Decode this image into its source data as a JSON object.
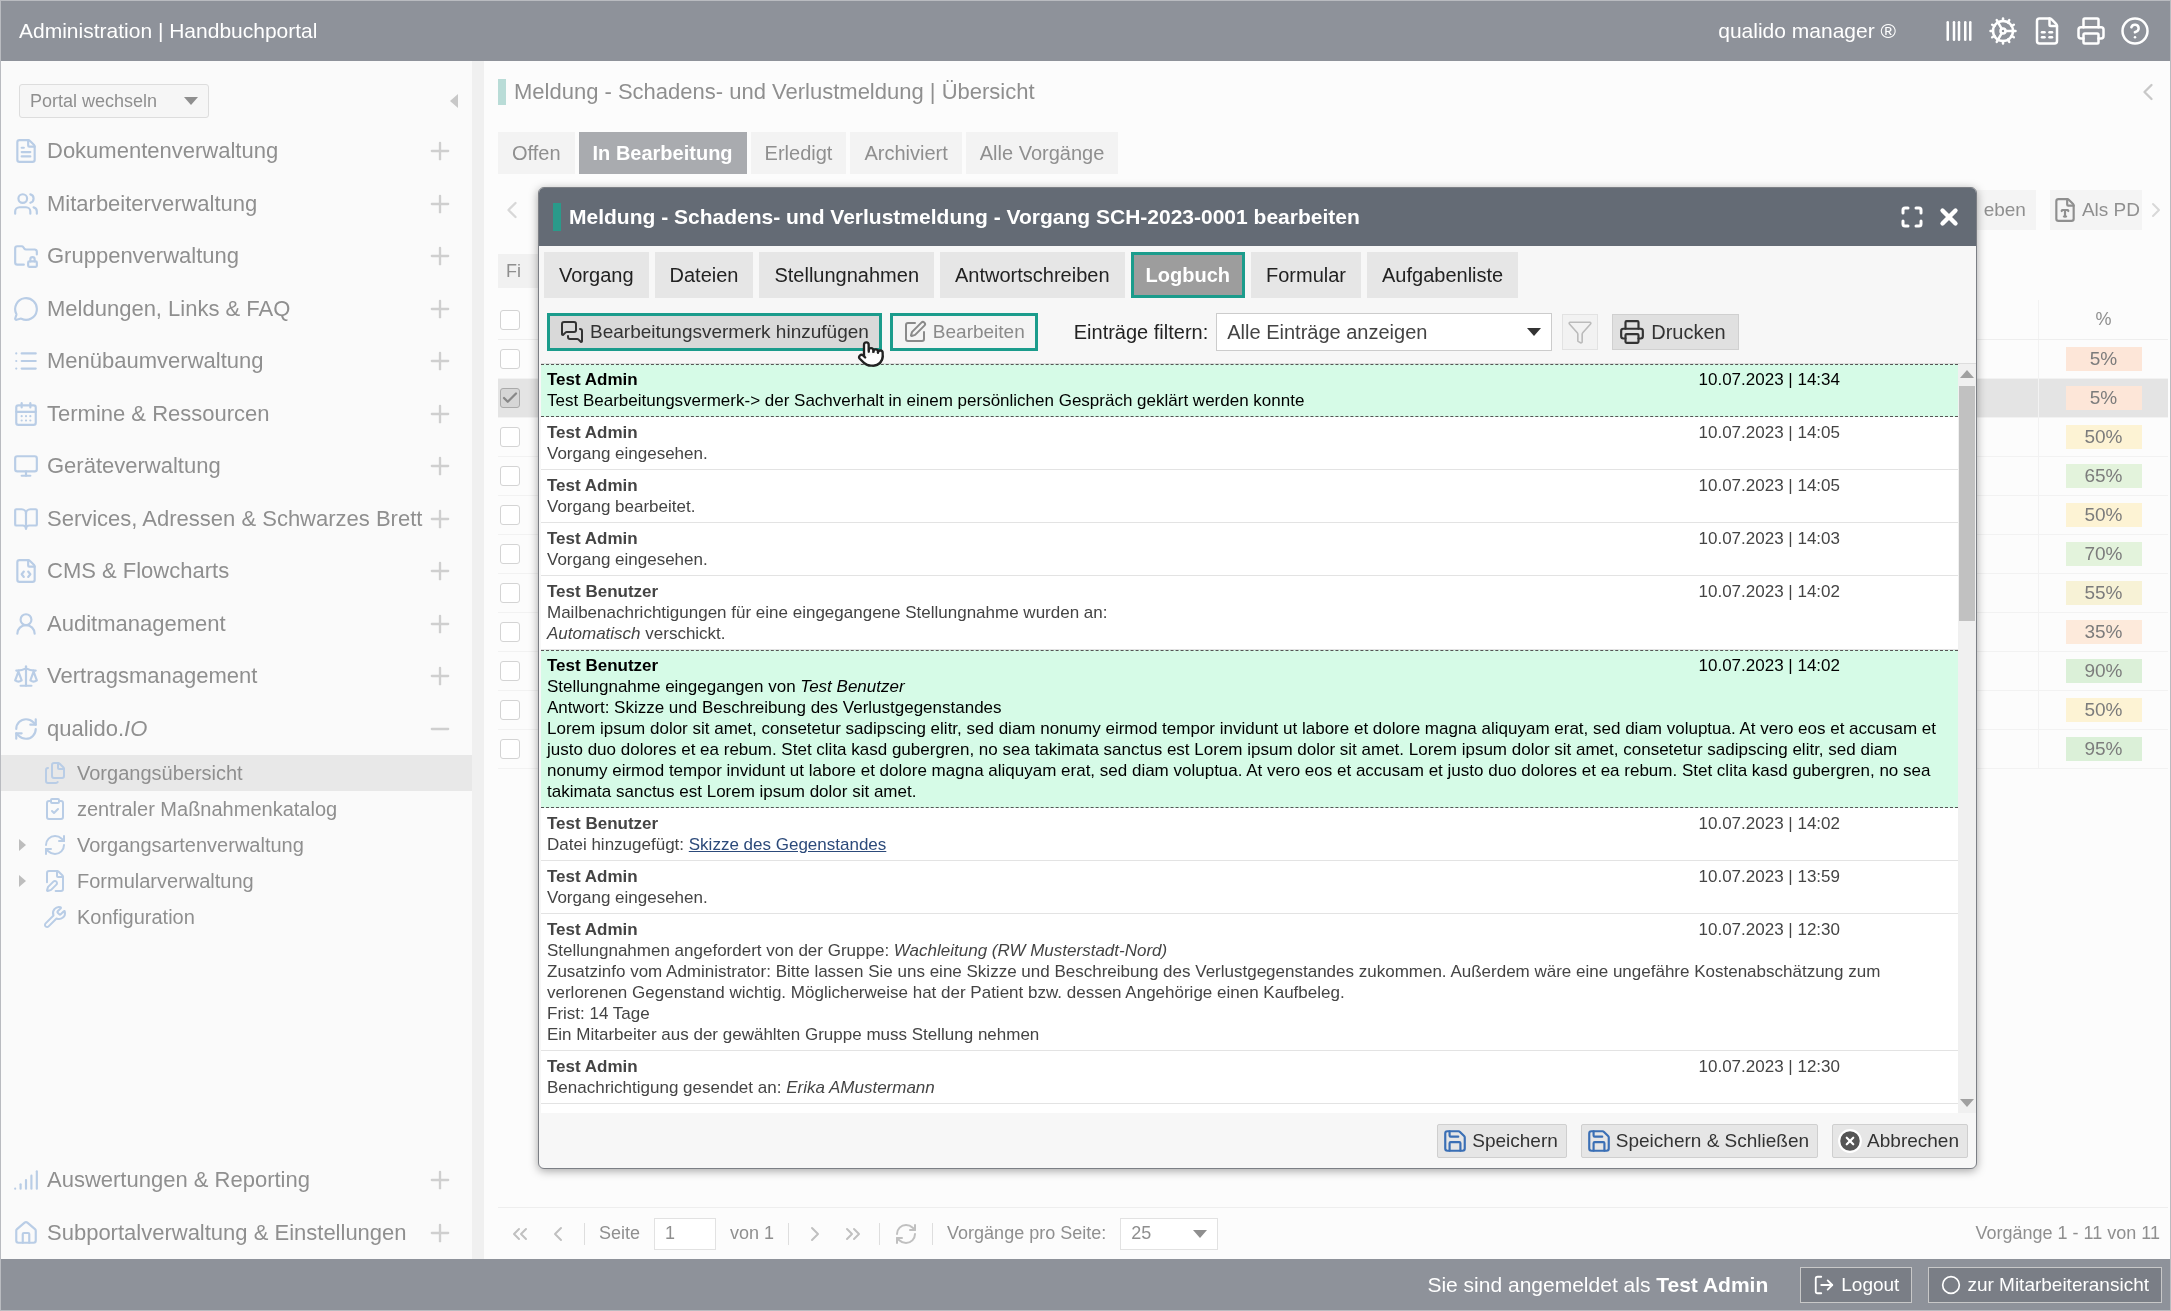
{
  "header": {
    "title": "Administration | Handbuchportal",
    "brand": "qualido manager ®"
  },
  "sidebar": {
    "portal_select": "Portal wechseln",
    "items": [
      {
        "label": "Dokumentenverwaltung",
        "expanded": false
      },
      {
        "label": "Mitarbeiterverwaltung",
        "expanded": false
      },
      {
        "label": "Gruppenverwaltung",
        "expanded": false
      },
      {
        "label": "Meldungen, Links & FAQ",
        "expanded": false
      },
      {
        "label": "Menübaumverwaltung",
        "expanded": false
      },
      {
        "label": "Termine & Ressourcen",
        "expanded": false
      },
      {
        "label": "Geräteverwaltung",
        "expanded": false
      },
      {
        "label": "Services, Adressen & Schwarzes Brett",
        "expanded": false
      },
      {
        "label": "CMS & Flowcharts",
        "expanded": false
      },
      {
        "label": "Auditmanagement",
        "expanded": false
      },
      {
        "label": "Vertragsmanagement",
        "expanded": false
      },
      {
        "label": "qualido.*IO*",
        "expanded": true,
        "children": [
          {
            "label": "Vorgangsübersicht",
            "kind": "page",
            "selected": true
          },
          {
            "label": "zentraler Maßnahmenkatalog",
            "kind": "page",
            "selected": false
          },
          {
            "label": "Vorgangsartenverwaltung",
            "kind": "group",
            "selected": false
          },
          {
            "label": "Formularverwaltung",
            "kind": "group",
            "selected": false
          },
          {
            "label": "Konfiguration",
            "kind": "page",
            "selected": false
          }
        ]
      }
    ],
    "bottom_items": [
      {
        "label": "Auswertungen & Reporting",
        "expanded": false
      },
      {
        "label": "Subportalverwaltung & Einstellungen",
        "expanded": false
      }
    ]
  },
  "content": {
    "title": "Meldung - Schadens- und Verlustmeldung | Übersicht",
    "tabs": [
      {
        "label": "Offen",
        "selected": false
      },
      {
        "label": "In Bearbeitung",
        "selected": true
      },
      {
        "label": "Erledigt",
        "selected": false
      },
      {
        "label": "Archiviert",
        "selected": false
      },
      {
        "label": "Alle Vorgänge",
        "selected": false
      }
    ],
    "toolbar_buttons": [
      {
        "label": "eben",
        "kind": "text"
      },
      {
        "label": "Als PD",
        "kind": "pdf"
      }
    ],
    "filter_stub": "Fi",
    "table": {
      "percent_header": "%",
      "select_all_checked": false,
      "rows": [
        {
          "checked": false,
          "selected": false,
          "percent": "5%",
          "color": "#fde6d8"
        },
        {
          "checked": true,
          "selected": true,
          "percent": "5%",
          "color": "#fde6d8"
        },
        {
          "checked": false,
          "selected": false,
          "percent": "50%",
          "color": "#fdf3d4"
        },
        {
          "checked": false,
          "selected": false,
          "percent": "65%",
          "color": "#e3f3dc"
        },
        {
          "checked": false,
          "selected": false,
          "percent": "50%",
          "color": "#fdf3d4"
        },
        {
          "checked": false,
          "selected": false,
          "percent": "70%",
          "color": "#e3f3dc"
        },
        {
          "checked": false,
          "selected": false,
          "percent": "55%",
          "color": "#f7f2d6"
        },
        {
          "checked": false,
          "selected": false,
          "percent": "35%",
          "color": "#fdeadb"
        },
        {
          "checked": false,
          "selected": false,
          "percent": "90%",
          "color": "#dbf0d8"
        },
        {
          "checked": false,
          "selected": false,
          "percent": "50%",
          "color": "#fdf3d4"
        },
        {
          "checked": false,
          "selected": false,
          "percent": "95%",
          "color": "#dbf0d8"
        }
      ]
    }
  },
  "pagination": {
    "page_label": "Seite",
    "page": "1",
    "of": "von 1",
    "per_page_label": "Vorgänge pro Seite:",
    "per_page": "25",
    "summary": "Vorgänge 1 - 11 von 11"
  },
  "footer": {
    "login_text": "Sie sind angemeldet als **Test Admin**",
    "buttons": [
      {
        "label": "Logout",
        "kind": "logout"
      },
      {
        "label": "zur Mitarbeiteransicht",
        "kind": "staff"
      }
    ]
  },
  "dialog": {
    "title": "Meldung - Schadens- und Verlustmeldung - Vorgang SCH-2023-0001 bearbeiten",
    "tabs": [
      {
        "label": "Vorgang",
        "selected": false
      },
      {
        "label": "Dateien",
        "selected": false
      },
      {
        "label": "Stellungnahmen",
        "selected": false
      },
      {
        "label": "Antwortschreiben",
        "selected": false
      },
      {
        "label": "Logbuch",
        "selected": true
      },
      {
        "label": "Formular",
        "selected": false
      },
      {
        "label": "Aufgabenliste",
        "selected": false
      }
    ],
    "add_note": "Bearbeitungsvermerk hinzufügen",
    "edit": {
      "label": "Bearbeiten",
      "disabled": true
    },
    "filter_label": "Einträge filtern:",
    "filter_value": "Alle Einträge anzeigen",
    "print": "Drucken",
    "entries": [
      {
        "author": "Test Admin",
        "date": "10.07.2023 | 14:34",
        "highlighted": true,
        "lines": [
          "Test Bearbeitungsvermerk-> der Sachverhalt in einem persönlichen Gespräch geklärt werden konnte"
        ]
      },
      {
        "author": "Test Admin",
        "date": "10.07.2023 | 14:05",
        "highlighted": false,
        "lines": [
          "Vorgang eingesehen."
        ]
      },
      {
        "author": "Test Admin",
        "date": "10.07.2023 | 14:05",
        "highlighted": false,
        "lines": [
          "Vorgang bearbeitet."
        ]
      },
      {
        "author": "Test Admin",
        "date": "10.07.2023 | 14:03",
        "highlighted": false,
        "lines": [
          "Vorgang eingesehen."
        ]
      },
      {
        "author": "Test Benutzer",
        "date": "10.07.2023 | 14:02",
        "highlighted": false,
        "lines": [
          "Mailbenachrichtigungen für eine eingegangene Stellungnahme wurden an:",
          "*Automatisch* verschickt."
        ]
      },
      {
        "author": "Test Benutzer",
        "date": "10.07.2023 | 14:02",
        "highlighted": true,
        "lines": [
          "Stellungnahme eingegangen von *Test Benutzer*",
          "Antwort: Skizze und Beschreibung des Verlustgegenstandes",
          "Lorem ipsum dolor sit amet, consetetur sadipscing elitr, sed diam nonumy eirmod tempor invidunt ut labore et dolore magna aliquyam erat, sed diam voluptua. At vero eos et accusam et justo duo dolores et ea rebum. Stet clita kasd gubergren, no sea takimata sanctus est Lorem ipsum dolor sit amet. Lorem ipsum dolor sit amet, consetetur sadipscing elitr, sed diam nonumy eirmod tempor invidunt ut labore et dolore magna aliquyam erat, sed diam voluptua. At vero eos et accusam et justo duo dolores et ea rebum. Stet clita kasd gubergren, no sea takimata sanctus est Lorem ipsum dolor sit amet."
        ]
      },
      {
        "author": "Test Benutzer",
        "date": "10.07.2023 | 14:02",
        "highlighted": false,
        "lines": [
          "Datei hinzugefügt:"
        ],
        "link": "Skizze des Gegenstandes"
      },
      {
        "author": "Test Admin",
        "date": "10.07.2023 | 13:59",
        "highlighted": false,
        "lines": [
          "Vorgang eingesehen."
        ]
      },
      {
        "author": "Test Admin",
        "date": "10.07.2023 | 12:30",
        "highlighted": false,
        "lines": [
          "Stellungnahmen angefordert von der Gruppe: *Wachleitung (RW Musterstadt-Nord)*",
          "Zusatzinfo vom Administrator: Bitte lassen Sie uns eine Skizze und Beschreibung des Verlustgegenstandes zukommen. Außerdem wäre eine ungefähre Kostenabschätzung zum verlorenen Gegenstand wichtig. Möglicherweise hat der Patient bzw. dessen Angehörige einen Kaufbeleg.",
          "Frist: 14 Tage",
          "Ein Mitarbeiter aus der gewählten Gruppe muss Stellung nehmen"
        ]
      },
      {
        "author": "Test Admin",
        "date": "10.07.2023 | 12:30",
        "highlighted": false,
        "lines": [
          "Benachrichtigung gesendet an: *Erika AMustermann*"
        ]
      }
    ],
    "buttons": [
      {
        "label": "Speichern",
        "kind": "save"
      },
      {
        "label": "Speichern & Schließen",
        "kind": "save"
      },
      {
        "label": "Abbrechen",
        "kind": "cancel"
      }
    ]
  }
}
